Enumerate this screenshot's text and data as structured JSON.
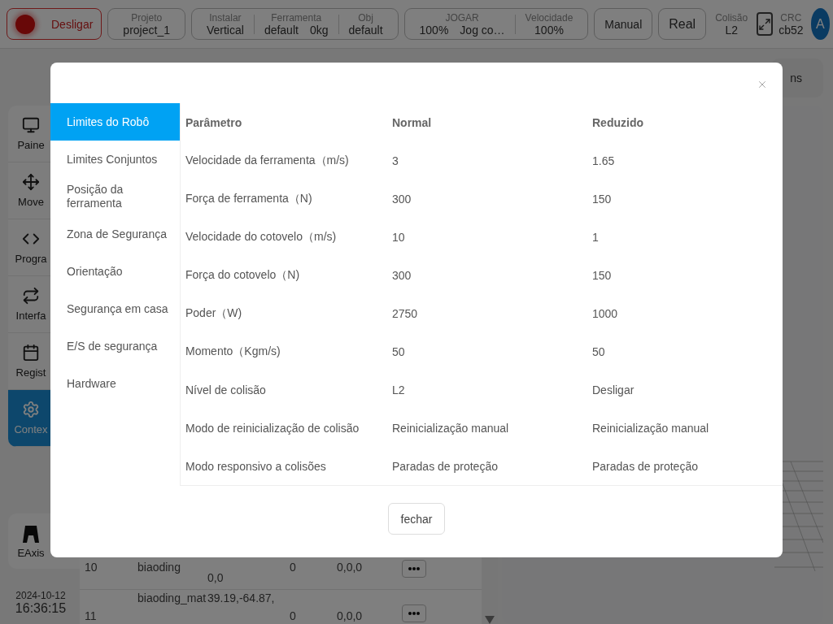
{
  "header": {
    "power_button": {
      "label": "Desligar"
    },
    "project": {
      "label": "Projeto",
      "value": "project_1"
    },
    "install_group": [
      {
        "label": "Instalar",
        "values": [
          "Vertical"
        ]
      },
      {
        "label": "Ferramenta",
        "values": [
          "default",
          "0kg"
        ]
      },
      {
        "label": "Obj",
        "values": [
          "default"
        ]
      }
    ],
    "jog_group": [
      {
        "label": "JOGAR",
        "values": [
          "100%",
          "Jog co…"
        ]
      },
      {
        "label": "Velocidade",
        "values": [
          "100%"
        ]
      }
    ],
    "mode_buttons": [
      "Manual",
      "Real"
    ],
    "collision": {
      "label": "Colisão",
      "value": "L2"
    },
    "crc": {
      "label": "CRC",
      "value": "cb52"
    },
    "avatar": "A"
  },
  "sidebar": {
    "items": [
      {
        "label": "Paine",
        "kind": "monitor",
        "selected": false
      },
      {
        "label": "Move",
        "kind": "move",
        "selected": false
      },
      {
        "label": "Progra",
        "kind": "code",
        "selected": false
      },
      {
        "label": "Interfa",
        "kind": "repeat",
        "selected": false
      },
      {
        "label": "Regist",
        "kind": "calendar",
        "selected": false
      },
      {
        "label": "Contex",
        "kind": "settings",
        "selected": true
      }
    ],
    "extra": {
      "label": "EAxis"
    },
    "date": "2024-10-12",
    "time": "16:36:15"
  },
  "toolbar": {
    "button": "ns"
  },
  "table": {
    "rows": [
      {
        "cells": [
          "10",
          "biaoding",
          "0,0",
          "0",
          "0,0,0"
        ]
      },
      {
        "cells": [
          "11",
          "biaoding_mat",
          "39.19,-64.87,",
          "0",
          "0,0,0"
        ]
      }
    ]
  },
  "dialog": {
    "menu": [
      {
        "label": "Limites do Robô",
        "selected": true
      },
      {
        "label": "Limites Conjuntos",
        "selected": false
      },
      {
        "label": "Posição da ferramenta",
        "selected": false
      },
      {
        "label": "Zona de Segurança",
        "selected": false
      },
      {
        "label": "Orientação",
        "selected": false
      },
      {
        "label": "Segurança em casa",
        "selected": false
      },
      {
        "label": "E/S de segurança",
        "selected": false
      },
      {
        "label": "Hardware",
        "selected": false
      }
    ],
    "columns": [
      "Parâmetro",
      "Normal",
      "Reduzido"
    ],
    "rows": [
      {
        "parameter": "Velocidade da ferramenta（m/s)",
        "normal": "3",
        "reduced": "1.65"
      },
      {
        "parameter": "Força de ferramenta（N)",
        "normal": "300",
        "reduced": "150"
      },
      {
        "parameter": "Velocidade do cotovelo（m/s)",
        "normal": "10",
        "reduced": "1"
      },
      {
        "parameter": "Força do cotovelo（N)",
        "normal": "300",
        "reduced": "150"
      },
      {
        "parameter": "Poder（W)",
        "normal": "2750",
        "reduced": "1000"
      },
      {
        "parameter": "Momento（Kgm/s)",
        "normal": "50",
        "reduced": "50"
      },
      {
        "parameter": "Nível de colisão",
        "normal": "L2",
        "reduced": "Desligar"
      },
      {
        "parameter": "Modo de reinicialização de colisão",
        "normal": "Reinicialização manual",
        "reduced": "Reinicialização manual"
      },
      {
        "parameter": "Modo responsivo a colisões",
        "normal": "Paradas de proteção",
        "reduced": "Paradas de proteção"
      }
    ],
    "close_button": "fechar"
  }
}
